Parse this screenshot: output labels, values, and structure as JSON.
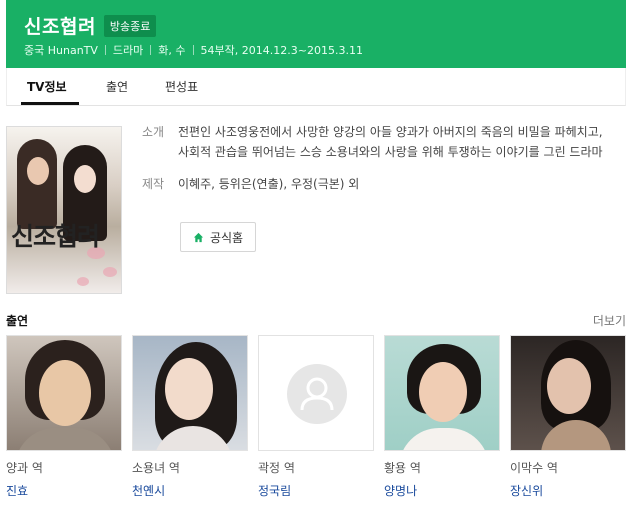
{
  "header": {
    "title": "신조협려",
    "badge": "방송종료",
    "meta": [
      "중국 HunanTV",
      "드라마",
      "화, 수",
      "54부작, 2014.12.3~2015.3.11"
    ]
  },
  "tabs": [
    {
      "label": "TV정보",
      "active": true
    },
    {
      "label": "출연",
      "active": false
    },
    {
      "label": "편성표",
      "active": false
    }
  ],
  "poster": {
    "title_text": "신조협려"
  },
  "info": {
    "synopsis_label": "소개",
    "synopsis": "전편인 사조영웅전에서 사망한 양강의 아들 양과가 아버지의 죽음의 비밀을 파헤치고, 사회적 관습을 뛰어넘는 스승 소용녀와의 사랑을 위해 투쟁하는 이야기를 그린 드라마",
    "production_label": "제작",
    "production": "이혜주, 등위은(연출), 우정(극본) 외",
    "home_button": "공식홈"
  },
  "cast_section": {
    "title": "출연",
    "more": "더보기",
    "members": [
      {
        "role": "양과 역",
        "actor": "진효"
      },
      {
        "role": "소용녀 역",
        "actor": "천옌시"
      },
      {
        "role": "곽정 역",
        "actor": "정국림"
      },
      {
        "role": "황용 역",
        "actor": "양명나"
      },
      {
        "role": "이막수 역",
        "actor": "장신위"
      }
    ]
  },
  "colors": {
    "brand_green": "#19b065",
    "link_blue": "#1a4a9c"
  },
  "icons": {
    "home": "home-icon",
    "placeholder": "person-placeholder-icon"
  }
}
